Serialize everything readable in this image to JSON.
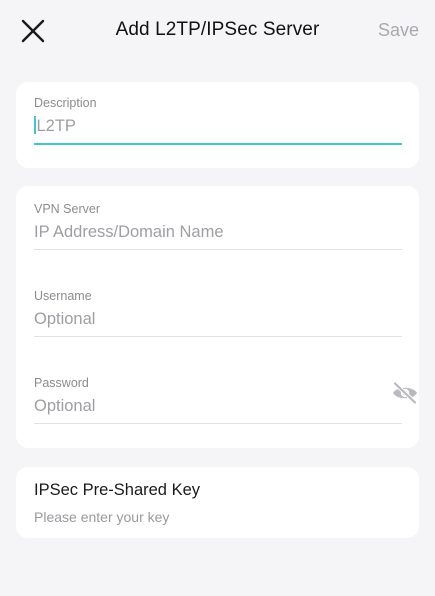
{
  "header": {
    "title": "Add L2TP/IPSec Server",
    "save_label": "Save"
  },
  "description": {
    "label": "Description",
    "value": "L2TP"
  },
  "vpn_server": {
    "label": "VPN Server",
    "placeholder": "IP Address/Domain Name"
  },
  "username": {
    "label": "Username",
    "placeholder": "Optional"
  },
  "password": {
    "label": "Password",
    "placeholder": "Optional"
  },
  "psk": {
    "title": "IPSec Pre-Shared Key",
    "placeholder": "Please enter your key"
  },
  "colors": {
    "accent": "#3ec6d3",
    "background": "#f5f5f7",
    "card": "#ffffff"
  },
  "icons": {
    "close": "close-icon",
    "password_visibility": "eye-off-icon"
  }
}
